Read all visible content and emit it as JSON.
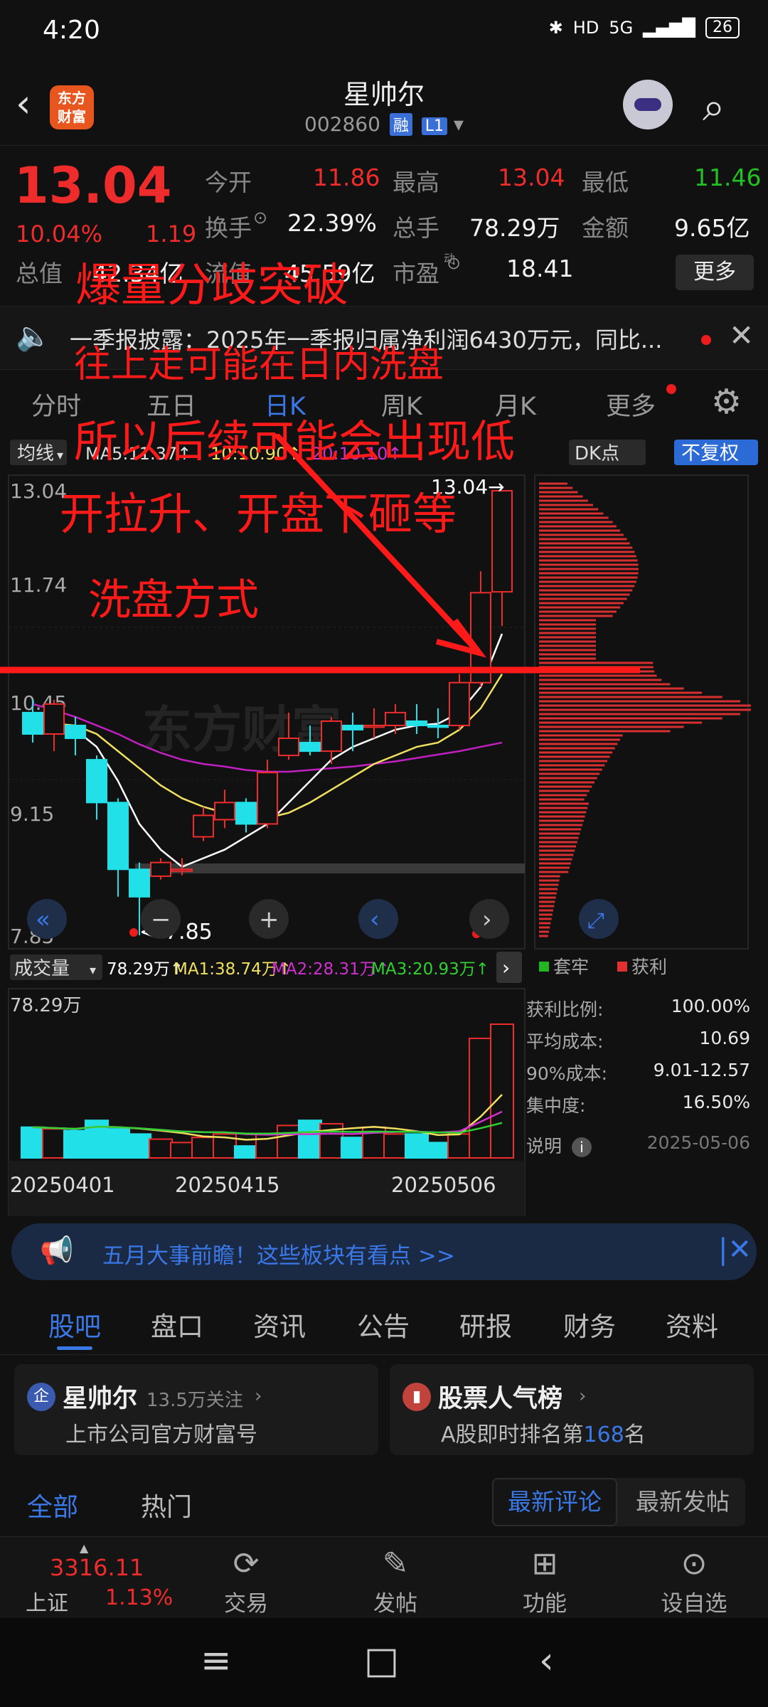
{
  "status_bar": {
    "time": "4:20",
    "network": "5G",
    "battery": "26"
  },
  "header": {
    "logo_text": "东方财富",
    "name": "星帅尔",
    "code": "002860",
    "tag1": "融",
    "tag2": "L1"
  },
  "quote": {
    "price": "13.04",
    "pct": "10.04%",
    "change": "1.19",
    "open_label": "今开",
    "open": "11.86",
    "high_label": "最高",
    "high": "13.04",
    "low_label": "最低",
    "low": "11.46",
    "turnover_label": "换手",
    "turnover": "22.39%",
    "volume_label": "总手",
    "volume": "78.29万",
    "amount_label": "金额",
    "amount": "9.65亿",
    "mktcap_label": "总值",
    "mktcap": "42.34亿",
    "float_label": "流值",
    "float": "45.59亿",
    "pe_label": "市盈",
    "pe_sup": "动",
    "pe": "18.41",
    "more": "更多"
  },
  "notice": {
    "text": "一季报披露：2025年一季报归属净利润6430万元，同比..."
  },
  "tabs": [
    "分时",
    "五日",
    "日K",
    "周K",
    "月K",
    "更多"
  ],
  "kline_bar": {
    "indicator": "均线",
    "ma5": "MA5:11.37↑",
    "ma10": "10:10.90↑",
    "ma20": "20:10.10↑",
    "dk": "DK点",
    "restore": "不复权"
  },
  "chart_data": {
    "type": "candlestick",
    "y_ticks": [
      "13.04",
      "11.74",
      "10.45",
      "9.15",
      "7.85"
    ],
    "ylim": [
      7.85,
      13.04
    ],
    "high_label": "13.04",
    "low_label": "7.85",
    "candles": [
      {
        "o": 10.45,
        "c": 10.2,
        "h": 10.6,
        "l": 10.1
      },
      {
        "o": 10.2,
        "c": 10.55,
        "h": 10.6,
        "l": 10.0
      },
      {
        "o": 10.3,
        "c": 10.15,
        "h": 10.4,
        "l": 9.95
      },
      {
        "o": 9.9,
        "c": 9.4,
        "h": 9.95,
        "l": 9.2
      },
      {
        "o": 9.4,
        "c": 8.62,
        "h": 9.45,
        "l": 8.3
      },
      {
        "o": 8.62,
        "c": 8.3,
        "h": 8.7,
        "l": 7.85
      },
      {
        "o": 8.54,
        "c": 8.7,
        "h": 8.75,
        "l": 8.5
      },
      {
        "o": 8.6,
        "c": 8.62,
        "h": 8.75,
        "l": 8.55
      },
      {
        "o": 9.0,
        "c": 9.25,
        "h": 9.35,
        "l": 8.95
      },
      {
        "o": 9.2,
        "c": 9.4,
        "h": 9.55,
        "l": 9.1
      },
      {
        "o": 9.4,
        "c": 9.15,
        "h": 9.45,
        "l": 9.05
      },
      {
        "o": 9.15,
        "c": 9.75,
        "h": 9.9,
        "l": 9.1
      },
      {
        "o": 9.95,
        "c": 10.15,
        "h": 10.45,
        "l": 9.9
      },
      {
        "o": 10.1,
        "c": 10.0,
        "h": 10.3,
        "l": 9.95
      },
      {
        "o": 10.0,
        "c": 10.35,
        "h": 10.4,
        "l": 9.85
      },
      {
        "o": 10.3,
        "c": 10.25,
        "h": 10.45,
        "l": 10.0
      },
      {
        "o": 10.28,
        "c": 10.3,
        "h": 10.5,
        "l": 10.15
      },
      {
        "o": 10.3,
        "c": 10.45,
        "h": 10.55,
        "l": 10.2
      },
      {
        "o": 10.35,
        "c": 10.3,
        "h": 10.55,
        "l": 10.2
      },
      {
        "o": 10.3,
        "c": 10.28,
        "h": 10.5,
        "l": 10.15
      },
      {
        "o": 10.3,
        "c": 10.8,
        "h": 10.9,
        "l": 10.25
      },
      {
        "o": 10.8,
        "c": 11.85,
        "h": 12.1,
        "l": 10.75
      },
      {
        "o": 11.86,
        "c": 13.04,
        "h": 13.04,
        "l": 11.46
      }
    ],
    "ma_white": [
      10.4,
      10.3,
      10.25,
      10.05,
      9.65,
      9.15,
      8.85,
      8.65,
      8.75,
      8.85,
      9.0,
      9.15,
      9.4,
      9.65,
      9.9,
      10.05,
      10.15,
      10.25,
      10.3,
      10.32,
      10.45,
      10.75,
      11.37
    ],
    "ma_yellow": [
      10.35,
      10.32,
      10.3,
      10.2,
      10.0,
      9.8,
      9.6,
      9.45,
      9.35,
      9.28,
      9.25,
      9.22,
      9.28,
      9.4,
      9.55,
      9.7,
      9.85,
      9.95,
      10.05,
      10.1,
      10.25,
      10.5,
      10.9
    ],
    "ma_magenta": [
      10.55,
      10.48,
      10.4,
      10.3,
      10.2,
      10.08,
      9.98,
      9.9,
      9.85,
      9.82,
      9.78,
      9.76,
      9.76,
      9.78,
      9.8,
      9.82,
      9.85,
      9.88,
      9.92,
      9.96,
      10.0,
      10.05,
      10.1
    ],
    "volume_series": [
      18,
      17,
      16,
      22,
      17,
      14,
      11,
      9,
      12,
      14,
      7,
      14,
      19,
      22,
      20,
      12,
      18,
      14,
      14,
      9,
      14,
      70,
      78.29
    ],
    "volume_max_label": "78.29万",
    "date_ticks": [
      "20250401",
      "20250415",
      "20250506"
    ]
  },
  "volume_bar": {
    "indicator": "成交量",
    "val": "78.29万↑",
    "ma1": "MA1:38.74万↑",
    "ma2": "MA2:28.31万↑",
    "ma3": "MA3:20.93万↑"
  },
  "distribution": {
    "legend_trap": "套牢",
    "legend_profit": "获利",
    "rows": [
      {
        "label": "获利比例:",
        "value": "100.00%"
      },
      {
        "label": "平均成本:",
        "value": "10.69"
      },
      {
        "label": "90%成本:",
        "value": "9.01-12.57"
      },
      {
        "label": "集中度:",
        "value": "16.50%"
      }
    ],
    "note_label": "说明",
    "date": "2025-05-06"
  },
  "annotation": {
    "line1": "爆量分歧突破",
    "line2": "往上走可能在日内洗盘",
    "line3": "所以后续可能会出现低",
    "line4": "开拉升、开盘下砸等",
    "line5": "洗盘方式"
  },
  "watermark": "东方财富",
  "ad": {
    "text": "五月大事前瞻！这些板块有看点 >>"
  },
  "subtabs": [
    "股吧",
    "盘口",
    "资讯",
    "公告",
    "研报",
    "财务",
    "资料"
  ],
  "card_left": {
    "title": "星帅尔",
    "sub": "13.5万关注",
    "desc": "上市公司官方财富号",
    "icon": "企"
  },
  "card_right": {
    "title": "股票人气榜",
    "desc_pre": "A股即时排名第",
    "rank": "168",
    "desc_post": "名"
  },
  "filter": {
    "all": "全部",
    "hot": "热门",
    "sort_latest_comment": "最新评论",
    "sort_latest_post": "最新发帖"
  },
  "index": {
    "value": "3316.11",
    "name": "上证",
    "pct": "1.13%"
  },
  "nav": [
    "交易",
    "发帖",
    "功能",
    "设自选"
  ]
}
